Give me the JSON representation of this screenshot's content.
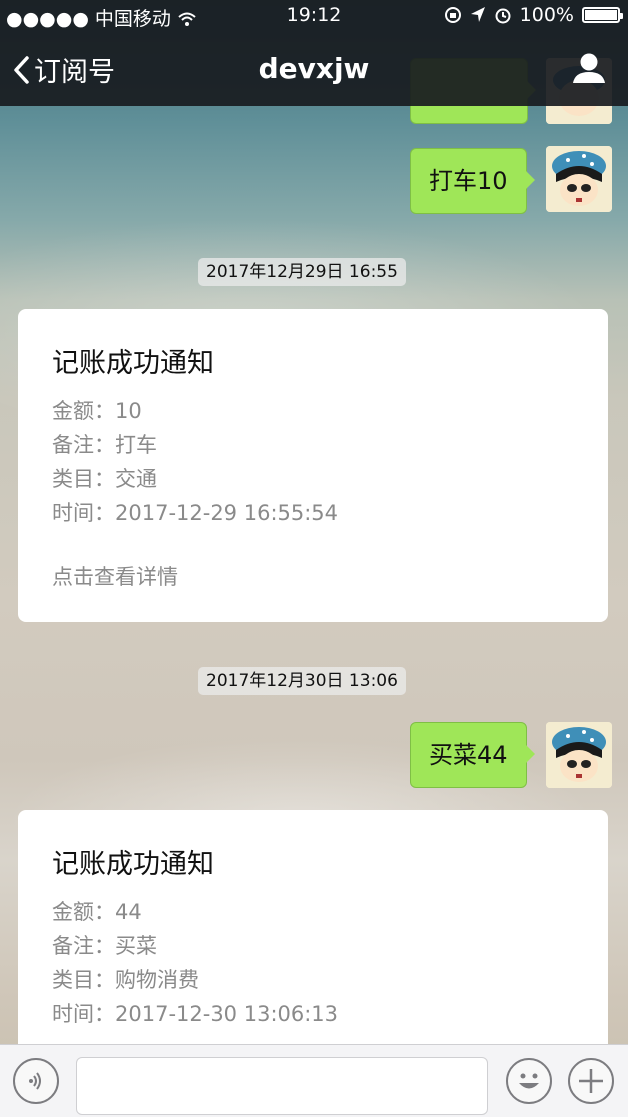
{
  "status_bar": {
    "carrier": "●●●●● 中国移动",
    "time": "19:12",
    "battery": "100%"
  },
  "nav": {
    "back_label": "订阅号",
    "title": "devxjw"
  },
  "messages": {
    "m1": {
      "text": "打车10"
    },
    "t1": {
      "text": "2017年12月29日 16:55"
    },
    "card1": {
      "title": "记账成功通知",
      "amount": "金额：10",
      "note": "备注：打车",
      "category": "类目：交通",
      "time": "时间：2017-12-29 16:55:54",
      "details": "点击查看详情"
    },
    "t2": {
      "text": "2017年12月30日 13:06"
    },
    "m2": {
      "text": "买菜44"
    },
    "card2": {
      "title": "记账成功通知",
      "amount": "金额：44",
      "note": "备注：买菜",
      "category": "类目：购物消费",
      "time": "时间：2017-12-30 13:06:13"
    }
  },
  "icons": {
    "voice": "voice-icon",
    "emoji": "emoji-icon",
    "add": "plus-icon",
    "user": "user-icon",
    "back": "chevron-left-icon"
  },
  "colors": {
    "bubble": "#9fe658",
    "navbar": "#181b20"
  }
}
